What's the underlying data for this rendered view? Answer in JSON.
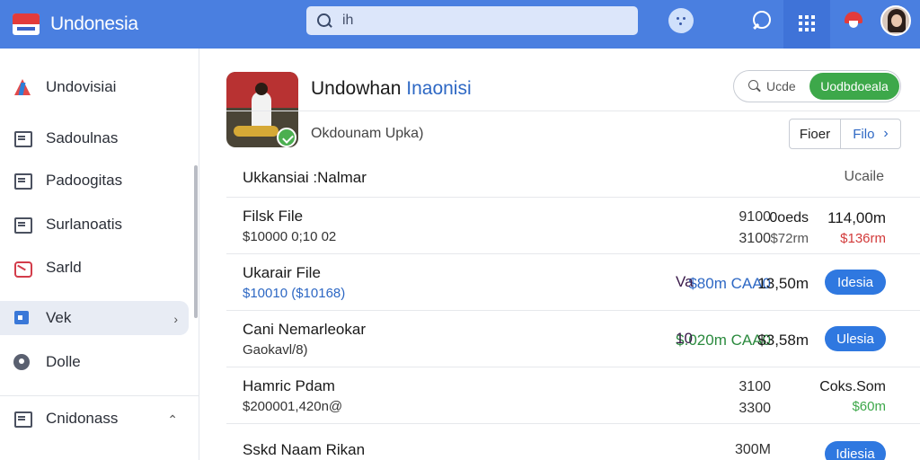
{
  "topbar": {
    "brand": "Undonesia",
    "search_value": "ih",
    "colors": {
      "bar": "#4a7fe0",
      "accent_red": "#e23b3b"
    }
  },
  "sidebar": {
    "items": [
      {
        "label": "Undovisiai",
        "icon": "logo-icon"
      },
      {
        "label": "Sadoulnas",
        "icon": "document-icon"
      },
      {
        "label": "Padoogitas",
        "icon": "document-icon"
      },
      {
        "label": "Surlanoatis",
        "icon": "document-icon"
      },
      {
        "label": "Sarld",
        "icon": "card-icon"
      },
      {
        "label": "Vek",
        "icon": "folder-icon",
        "active": true
      },
      {
        "label": "Dolle",
        "icon": "settings-icon"
      },
      {
        "label": "Cnidonass",
        "icon": "document-icon"
      }
    ]
  },
  "main": {
    "title_main": "Undowhan ",
    "title_accent": "Inaonisi",
    "subtitle": "Okdounam Upka)",
    "filter_search_label": "Ucde",
    "filter_button": "Uodbdoeala",
    "seg_a": "Fioer",
    "seg_b": "Filo",
    "table": {
      "header_left": "Ukkansiai :Nalmar",
      "header_right": "Ucaile",
      "rows": [
        {
          "name": "Filsk File",
          "sub": "$10000 0;10 02",
          "amt1": "9100",
          "amt2": "3100",
          "val1": "0oeds",
          "val2": "$72rm",
          "tot1": "114,00m",
          "tot2": "$136rm"
        },
        {
          "name": "Ukarair File",
          "sub": "$10010 ($10168)",
          "amt": "$80m CAA0",
          "code": "Va",
          "val": "13,50m",
          "button": "Idesia"
        },
        {
          "name": "Cani Nemarleokar",
          "sub": "Gaokavl/8)",
          "amt": "$.020m CAA0",
          "code": "10",
          "val": "$3,58m",
          "button": "Ulesia"
        },
        {
          "name": "Hamric Pdam",
          "sub": "$200001,420n@",
          "amt1": "3100",
          "amt2": "3300",
          "tot1": "Coks.Som",
          "tot2": "$60m"
        },
        {
          "name": "Sskd Naam Rikan",
          "amt1": "300M",
          "button": "Idiesia"
        }
      ]
    }
  }
}
